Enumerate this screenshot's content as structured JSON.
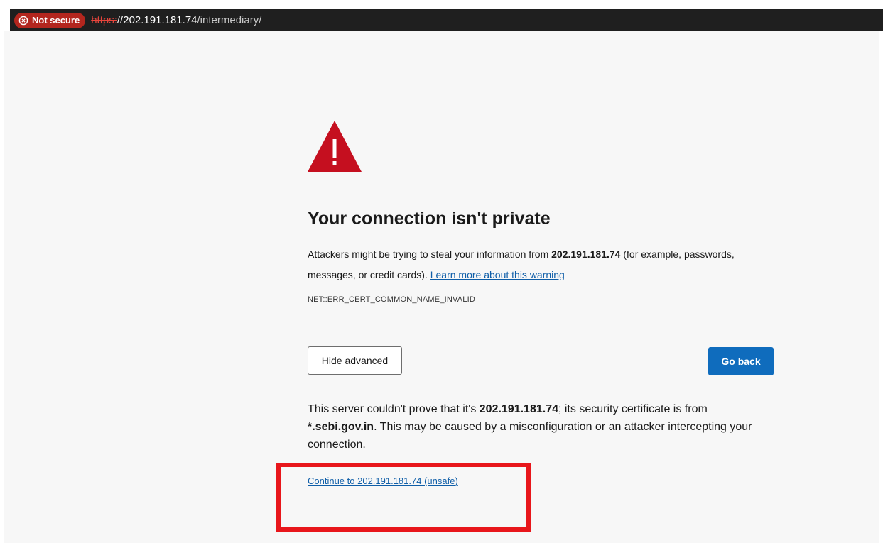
{
  "addressbar": {
    "security_label": "Not secure",
    "url_scheme": "https:",
    "url_sep": "//",
    "url_host": "202.191.181.74",
    "url_path": "/intermediary/",
    "security_icon": "shield-x-icon"
  },
  "warning": {
    "icon": "warning-triangle-icon",
    "title": "Your connection isn't private",
    "intro_1": "Attackers might be trying to steal your information from ",
    "intro_host": "202.191.181.74",
    "intro_2": " (for example, passwords, messages, or credit cards). ",
    "learn_more": "Learn more about this warning",
    "error_code": "NET::ERR_CERT_COMMON_NAME_INVALID"
  },
  "buttons": {
    "hide_advanced": "Hide advanced",
    "go_back": "Go back"
  },
  "advanced": {
    "text_1": "This server couldn't prove that it's ",
    "host": "202.191.181.74",
    "text_2": "; its security certificate is from ",
    "cert_domain": "*.sebi.gov.in",
    "text_3": ". This may be caused by a misconfiguration or an attacker intercepting your connection.",
    "continue_link": "Continue to 202.191.181.74 (unsafe)"
  },
  "colors": {
    "not_secure_pill": "#b3261e",
    "warning_red": "#c50f1f",
    "primary_button": "#0f6cbd",
    "link": "#0f5ea8",
    "highlight_box": "#e8161b"
  }
}
